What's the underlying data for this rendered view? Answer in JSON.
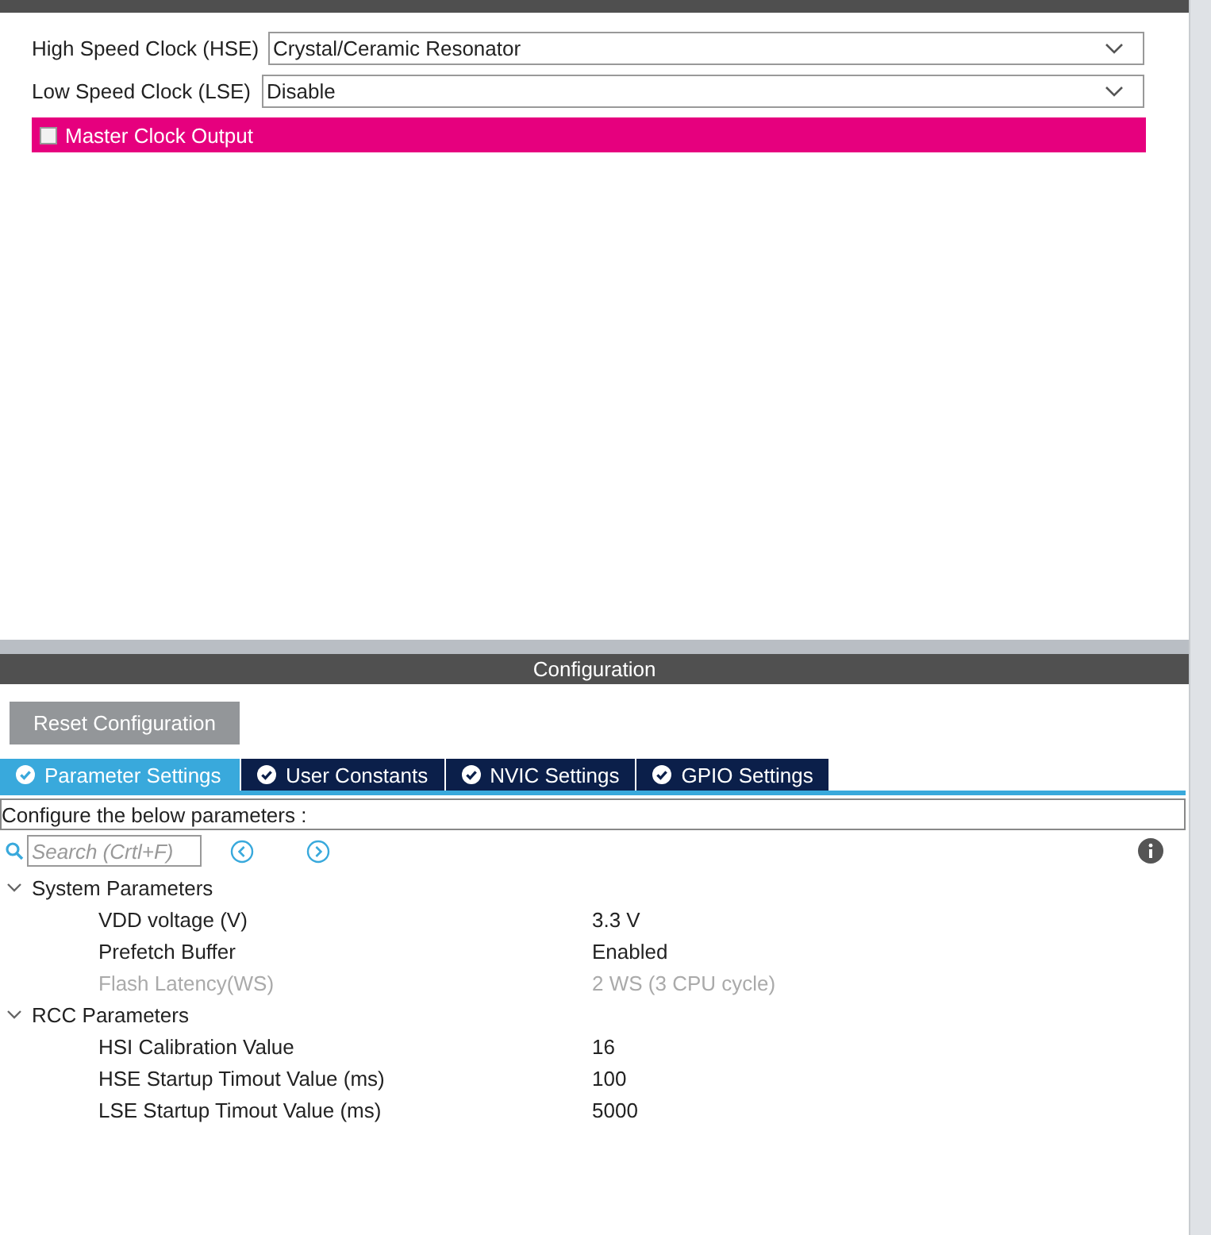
{
  "mode": {
    "fields": [
      {
        "label": "High Speed Clock (HSE)",
        "value": "Crystal/Ceramic Resonator"
      },
      {
        "label": "Low Speed Clock (LSE)",
        "value": "Disable"
      }
    ],
    "master_clock_output": {
      "label": "Master Clock Output",
      "checked": false
    }
  },
  "configuration": {
    "title": "Configuration",
    "reset_button": "Reset Configuration",
    "tabs": [
      {
        "label": "Parameter Settings",
        "selected": true
      },
      {
        "label": "User Constants",
        "selected": false
      },
      {
        "label": "NVIC Settings",
        "selected": false
      },
      {
        "label": "GPIO Settings",
        "selected": false
      }
    ],
    "hint": "Configure the below parameters :",
    "search": {
      "placeholder": "Search (Crtl+F)"
    },
    "tree": [
      {
        "label": "System Parameters",
        "expanded": true,
        "children": [
          {
            "label": "VDD voltage (V)",
            "value": "3.3 V",
            "disabled": false
          },
          {
            "label": "Prefetch Buffer",
            "value": "Enabled",
            "disabled": false
          },
          {
            "label": "Flash Latency(WS)",
            "value": "2 WS (3 CPU cycle)",
            "disabled": true
          }
        ]
      },
      {
        "label": "RCC Parameters",
        "expanded": true,
        "children": [
          {
            "label": "HSI Calibration Value",
            "value": "16",
            "disabled": false
          },
          {
            "label": "HSE Startup Timout Value (ms)",
            "value": "100",
            "disabled": false
          },
          {
            "label": "LSE Startup Timout Value (ms)",
            "value": "5000",
            "disabled": false
          }
        ]
      }
    ]
  }
}
